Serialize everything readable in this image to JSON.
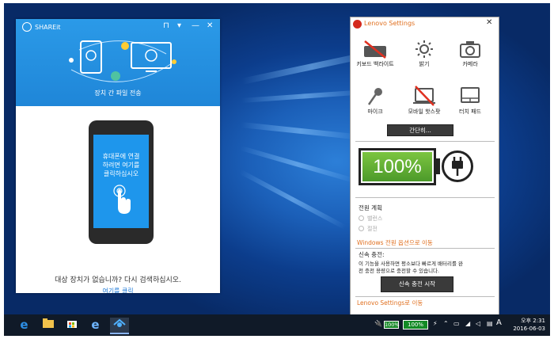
{
  "shareit": {
    "title": "SHAREit",
    "caption": "장치 간 파일 전송",
    "phone_text": [
      "휴대폰에 연결",
      "하려면 여기를",
      "클릭하십시오"
    ],
    "bottom_text": "대상 장치가 없습니까? 다시 검색하십시오.",
    "link_text": "여기를 클릭"
  },
  "lenovo": {
    "title": "Lenovo Settings",
    "tiles": [
      {
        "label": "키보드 백라이트",
        "icon": "keyboard-backlight-icon"
      },
      {
        "label": "밝기",
        "icon": "brightness-icon"
      },
      {
        "label": "카메라",
        "icon": "camera-icon"
      },
      {
        "label": "마이크",
        "icon": "microphone-icon"
      },
      {
        "label": "모바일 핫스팟",
        "icon": "mobile-hotspot-icon"
      },
      {
        "label": "터치 패드",
        "icon": "touchpad-icon"
      }
    ],
    "simple_button": "간단히...",
    "battery_percent": "100%",
    "power_plan_label": "전원 계획",
    "power_plan_options": [
      "밸런스",
      "절전"
    ],
    "windows_power_link": "Windows 전원 옵션으로 이동",
    "rapid_charge_label": "신속 충전:",
    "rapid_charge_desc_1": "이 기능을 사용하면 평소보다 빠르게 배터리를 완",
    "rapid_charge_desc_2": "전 충전 용량으로 충전할 수 있습니다.",
    "rapid_charge_button": "신속 충전 시작",
    "lenovo_link": "Lenovo Settings로 이동"
  },
  "taskbar": {
    "tray_battery_small": "100%",
    "tray_battery_large": "100%",
    "time": "오후 2:31",
    "date": "2016-06-03",
    "ime": "A"
  },
  "colors": {
    "shareit_blue": "#1f86d8",
    "lenovo_orange": "#e07020",
    "battery_green": "#5aad31",
    "taskbar": "#101a28"
  }
}
